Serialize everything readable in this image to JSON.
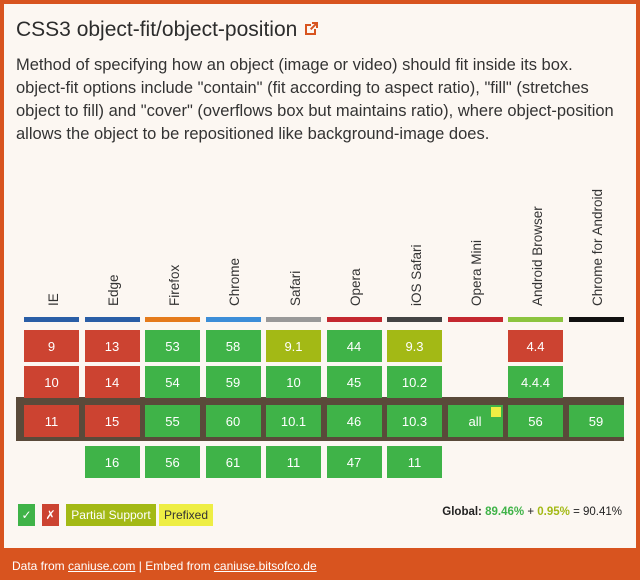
{
  "title": "CSS3 object-fit/object-position",
  "description": "Method of specifying how an object (image or video) should fit inside its box. object-fit options include \"contain\" (fit according to aspect ratio), \"fill\" (stretches object to fill) and \"cover\" (overflows box but maintains ratio), where object-position allows the object to be repositioned like background-image does.",
  "icons": {
    "external_link": "external-link-icon"
  },
  "colors": {
    "frame": "#d8541f",
    "yes": "#3fb348",
    "no": "#cc4331",
    "partial": "#a3b915",
    "prefixed": "#eeee44",
    "current_band": "#5a4a3a"
  },
  "browsers": [
    {
      "name": "IE",
      "bar": "#2a5ea6",
      "rows": [
        {
          "v": "9",
          "s": "red"
        },
        {
          "v": "10",
          "s": "red"
        },
        {
          "v": "11",
          "s": "red"
        },
        {
          "v": "",
          "s": ""
        }
      ]
    },
    {
      "name": "Edge",
      "bar": "#2a5ea6",
      "rows": [
        {
          "v": "13",
          "s": "red"
        },
        {
          "v": "14",
          "s": "red"
        },
        {
          "v": "15",
          "s": "red"
        },
        {
          "v": "16",
          "s": "green"
        }
      ]
    },
    {
      "name": "Firefox",
      "bar": "#e57b1c",
      "rows": [
        {
          "v": "53",
          "s": "green"
        },
        {
          "v": "54",
          "s": "green"
        },
        {
          "v": "55",
          "s": "green"
        },
        {
          "v": "56",
          "s": "green"
        }
      ]
    },
    {
      "name": "Chrome",
      "bar": "#3c8ed8",
      "rows": [
        {
          "v": "58",
          "s": "green"
        },
        {
          "v": "59",
          "s": "green"
        },
        {
          "v": "60",
          "s": "green"
        },
        {
          "v": "61",
          "s": "green"
        }
      ]
    },
    {
      "name": "Safari",
      "bar": "#999999",
      "rows": [
        {
          "v": "9.1",
          "s": "olive"
        },
        {
          "v": "10",
          "s": "green"
        },
        {
          "v": "10.1",
          "s": "green"
        },
        {
          "v": "11",
          "s": "green"
        }
      ]
    },
    {
      "name": "Opera",
      "bar": "#c4282f",
      "rows": [
        {
          "v": "44",
          "s": "green"
        },
        {
          "v": "45",
          "s": "green"
        },
        {
          "v": "46",
          "s": "green"
        },
        {
          "v": "47",
          "s": "green"
        }
      ]
    },
    {
      "name": "iOS Safari",
      "bar": "#444444",
      "rows": [
        {
          "v": "9.3",
          "s": "olive"
        },
        {
          "v": "10.2",
          "s": "green"
        },
        {
          "v": "10.3",
          "s": "green"
        },
        {
          "v": "11",
          "s": "green"
        }
      ]
    },
    {
      "name": "Opera Mini",
      "bar": "#c4282f",
      "rows": [
        {
          "v": "",
          "s": ""
        },
        {
          "v": "",
          "s": ""
        },
        {
          "v": "all",
          "s": "green",
          "flag": true
        },
        {
          "v": "",
          "s": ""
        }
      ]
    },
    {
      "name": "Android Browser",
      "bar": "#8cc43f",
      "rows": [
        {
          "v": "4.4",
          "s": "red"
        },
        {
          "v": "4.4.4",
          "s": "green"
        },
        {
          "v": "56",
          "s": "green"
        },
        {
          "v": "",
          "s": ""
        }
      ]
    },
    {
      "name": "Chrome for Android",
      "bar": "#111111",
      "rows": [
        {
          "v": "",
          "s": ""
        },
        {
          "v": "",
          "s": ""
        },
        {
          "v": "59",
          "s": "green"
        },
        {
          "v": "",
          "s": ""
        }
      ]
    }
  ],
  "legend": {
    "yes": "✓",
    "no": "✗",
    "partial": "Partial Support",
    "prefixed": "Prefixed"
  },
  "global": {
    "label": "Global:",
    "full": "89.46%",
    "plus": "+",
    "partial": "0.95%",
    "equals": "=",
    "total": "90.41%"
  },
  "footer": {
    "data_from": "Data from",
    "data_link": "caniuse.com",
    "sep": "|",
    "embed_from": "Embed from",
    "embed_link": "caniuse.bitsofco.de"
  }
}
